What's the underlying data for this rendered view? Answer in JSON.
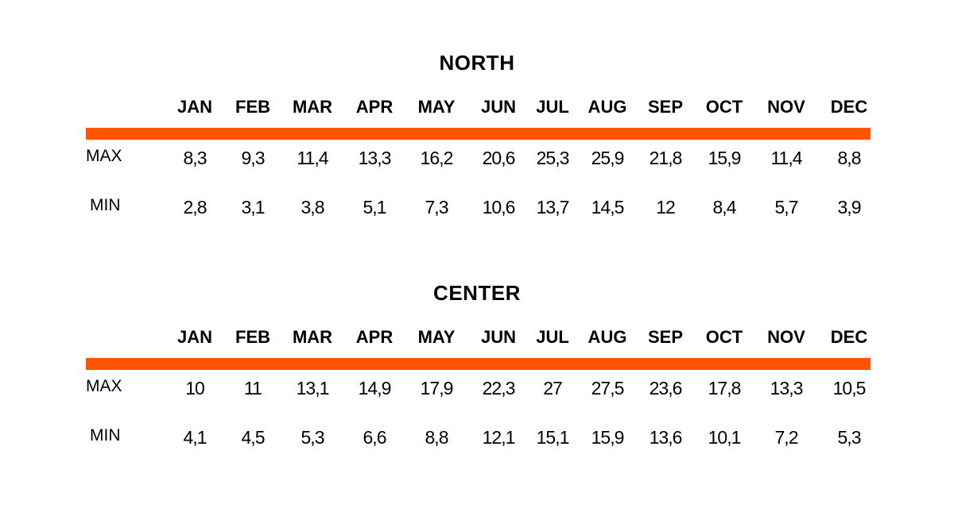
{
  "accent_color": "#FF5500",
  "chart_data": {
    "type": "table",
    "columns": [
      "JAN",
      "FEB",
      "MAR",
      "APR",
      "MAY",
      "JUN",
      "JUL",
      "AUG",
      "SEP",
      "OCT",
      "NOV",
      "DEC"
    ],
    "tables": [
      {
        "title": "NORTH",
        "rows": [
          {
            "label": "MAX",
            "values": [
              "8,3",
              "9,3",
              "11,4",
              "13,3",
              "16,2",
              "20,6",
              "25,3",
              "25,9",
              "21,8",
              "15,9",
              "11,4",
              "8,8"
            ]
          },
          {
            "label": "MIN",
            "values": [
              "2,8",
              "3,1",
              "3,8",
              "5,1",
              "7,3",
              "10,6",
              "13,7",
              "14,5",
              "12",
              "8,4",
              "5,7",
              "3,9"
            ]
          }
        ]
      },
      {
        "title": "CENTER",
        "rows": [
          {
            "label": "MAX",
            "values": [
              "10",
              "11",
              "13,1",
              "14,9",
              "17,9",
              "22,3",
              "27",
              "27,5",
              "23,6",
              "17,8",
              "13,3",
              "10,5"
            ]
          },
          {
            "label": "MIN",
            "values": [
              "4,1",
              "4,5",
              "5,3",
              "6,6",
              "8,8",
              "12,1",
              "15,1",
              "15,9",
              "13,6",
              "10,1",
              "7,2",
              "5,3"
            ]
          }
        ]
      }
    ]
  }
}
